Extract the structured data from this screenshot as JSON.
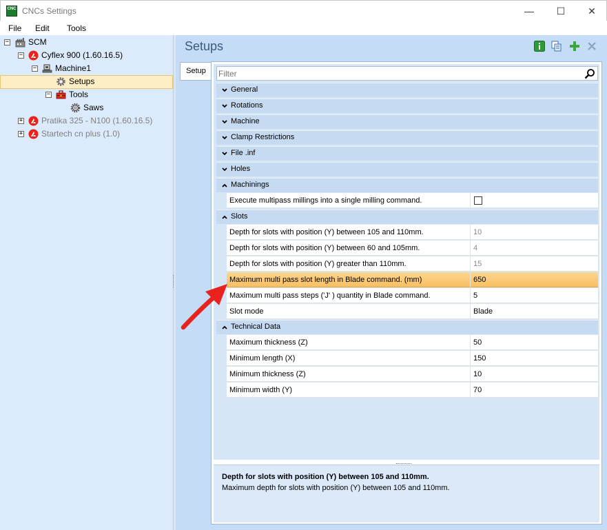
{
  "window": {
    "title": "CNCs Settings",
    "icon_text": "CNC",
    "minimize": "—",
    "maximize": "☐",
    "close": "✕"
  },
  "menu": [
    "File",
    "Edit",
    "Tools"
  ],
  "tree": {
    "collapse_glyph": "−",
    "expand_glyph": "+",
    "nodes": [
      {
        "label": "SCM"
      },
      {
        "label": "Cyflex 900 (1.60.16.5)"
      },
      {
        "label": "Machine1"
      },
      {
        "label": "Setups"
      },
      {
        "label": "Tools"
      },
      {
        "label": "Saws"
      },
      {
        "label": "Pratika 325 - N100 (1.60.16.5)"
      },
      {
        "label": "Startech cn plus (1.0)"
      }
    ]
  },
  "panel": {
    "title": "Setups",
    "tab_label": "Setup",
    "filter_placeholder": "Filter"
  },
  "categories": {
    "general": "General",
    "rotations": "Rotations",
    "machine": "Machine",
    "clamp": "Clamp Restrictions",
    "fileinf": "File .inf",
    "holes": "Holes",
    "machinings": "Machinings",
    "slots": "Slots",
    "technical": "Technical Data"
  },
  "machinings": [
    {
      "name": "Execute multipass millings into a single milling command.",
      "checked": false
    }
  ],
  "slots": [
    {
      "name": "Depth for slots with position (Y) between 105 and 110mm.",
      "value": "10"
    },
    {
      "name": "Depth for slots with position (Y) between 60 and 105mm.",
      "value": "4"
    },
    {
      "name": "Depth for slots with position (Y) greater than 110mm.",
      "value": "15"
    },
    {
      "name": "Maximum multi pass slot length in Blade command. (mm)",
      "value": "650"
    },
    {
      "name": "Maximum multi pass steps ('J' ) quantity in Blade command.",
      "value": "5"
    },
    {
      "name": "Slot mode",
      "value": "Blade"
    }
  ],
  "technical": [
    {
      "name": "Maximum thickness (Z)",
      "value": "50"
    },
    {
      "name": "Minimum length (X)",
      "value": "150"
    },
    {
      "name": "Minimum thickness (Z)",
      "value": "10"
    },
    {
      "name": "Minimum width (Y)",
      "value": "70"
    }
  ],
  "description": {
    "title": "Depth for slots with position (Y) between 105 and 110mm.",
    "text": "Maximum depth for slots with position (Y) between 105 and 110mm."
  },
  "colors": {
    "accent_red": "#e8231e",
    "highlight": "#f8bf62",
    "panel_bg": "#c4dcf5"
  }
}
